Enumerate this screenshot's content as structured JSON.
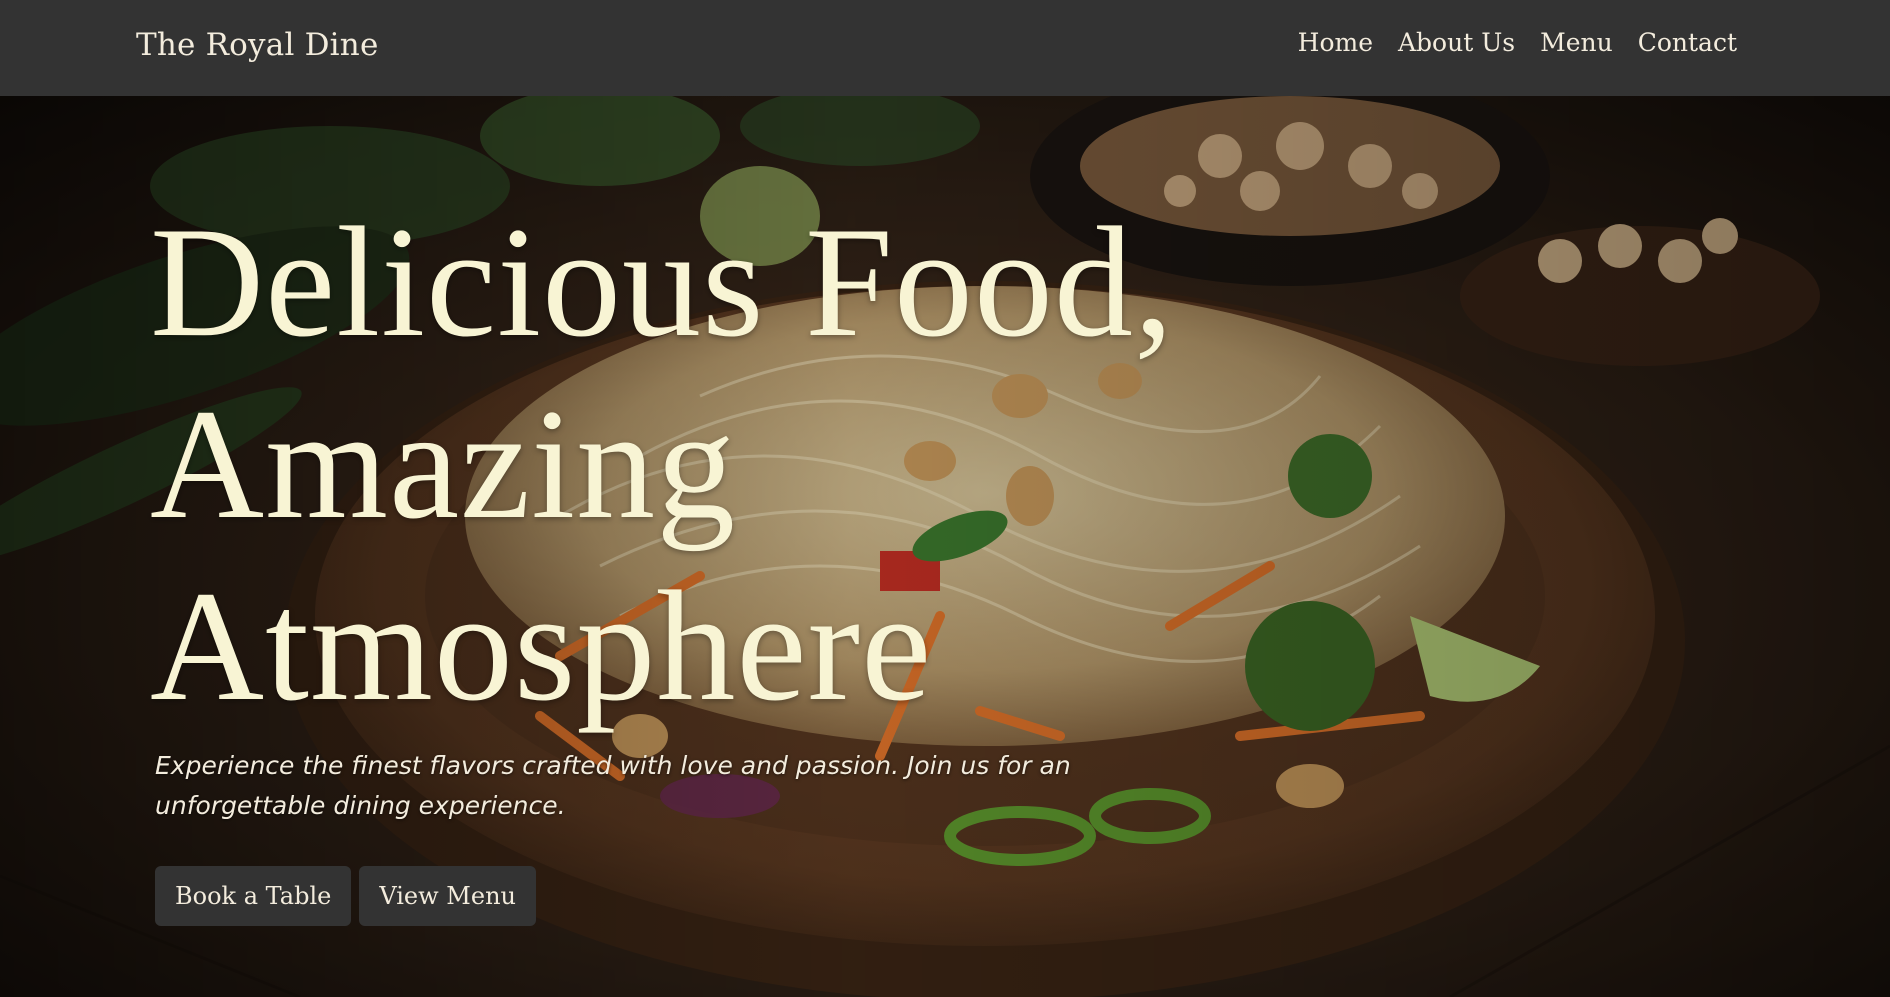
{
  "nav": {
    "brand": "The Royal Dine",
    "links": [
      "Home",
      "About Us",
      "Menu",
      "Contact"
    ]
  },
  "hero": {
    "title_lines": [
      "Delicious Food,",
      "Amazing",
      "Atmosphere"
    ],
    "subtitle": "Experience the finest flavors crafted with love and passion. Join us for an unforgettable dining experience.",
    "buttons": [
      "Book a Table",
      "View Menu"
    ],
    "background": "noodle-salad-dish-photo"
  },
  "colors": {
    "navbar": "#333333",
    "button": "#333333",
    "title": "#f8f4d4",
    "text": "#f3ecdd"
  }
}
